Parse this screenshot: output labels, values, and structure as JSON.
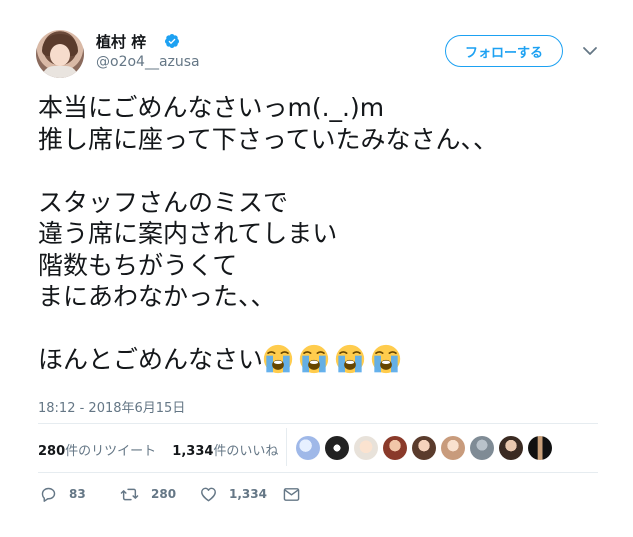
{
  "user": {
    "display_name": "植村 梓",
    "handle": "@o2o4__azusa",
    "verified": true,
    "avatar_icon": "profile-photo"
  },
  "follow_button": {
    "label": "フォローする"
  },
  "tweet": {
    "lines": [
      "本当にごめんなさいっm(._.)m",
      "推し席に座って下さっていたみなさん、、",
      "",
      "スタッフさんのミスで",
      "違う席に案内されてしまい",
      "階数もちがうくて",
      "まにあわなかった、、",
      "",
      "ほんとごめんなさい"
    ],
    "emoji": [
      "loudly-crying-face",
      "loudly-crying-face",
      "loudly-crying-face",
      "loudly-crying-face"
    ],
    "timestamp": "18:12 - 2018年6月15日"
  },
  "stats": {
    "retweets_count": "280",
    "retweets_label": "件のリツイート",
    "likes_count": "1,334",
    "likes_label": "件のいいね"
  },
  "likers": [
    "liker-avatar",
    "liker-avatar",
    "liker-avatar",
    "liker-avatar",
    "liker-avatar",
    "liker-avatar",
    "liker-avatar",
    "liker-avatar",
    "liker-avatar"
  ],
  "actions": {
    "reply_count": "83",
    "retweet_count": "280",
    "like_count": "1,334",
    "icons": [
      "reply-icon",
      "retweet-icon",
      "like-icon",
      "direct-message-icon"
    ]
  },
  "colors": {
    "accent": "#1da1f2",
    "text": "#14171a",
    "secondary": "#657786",
    "divider": "#e6ecf0"
  }
}
